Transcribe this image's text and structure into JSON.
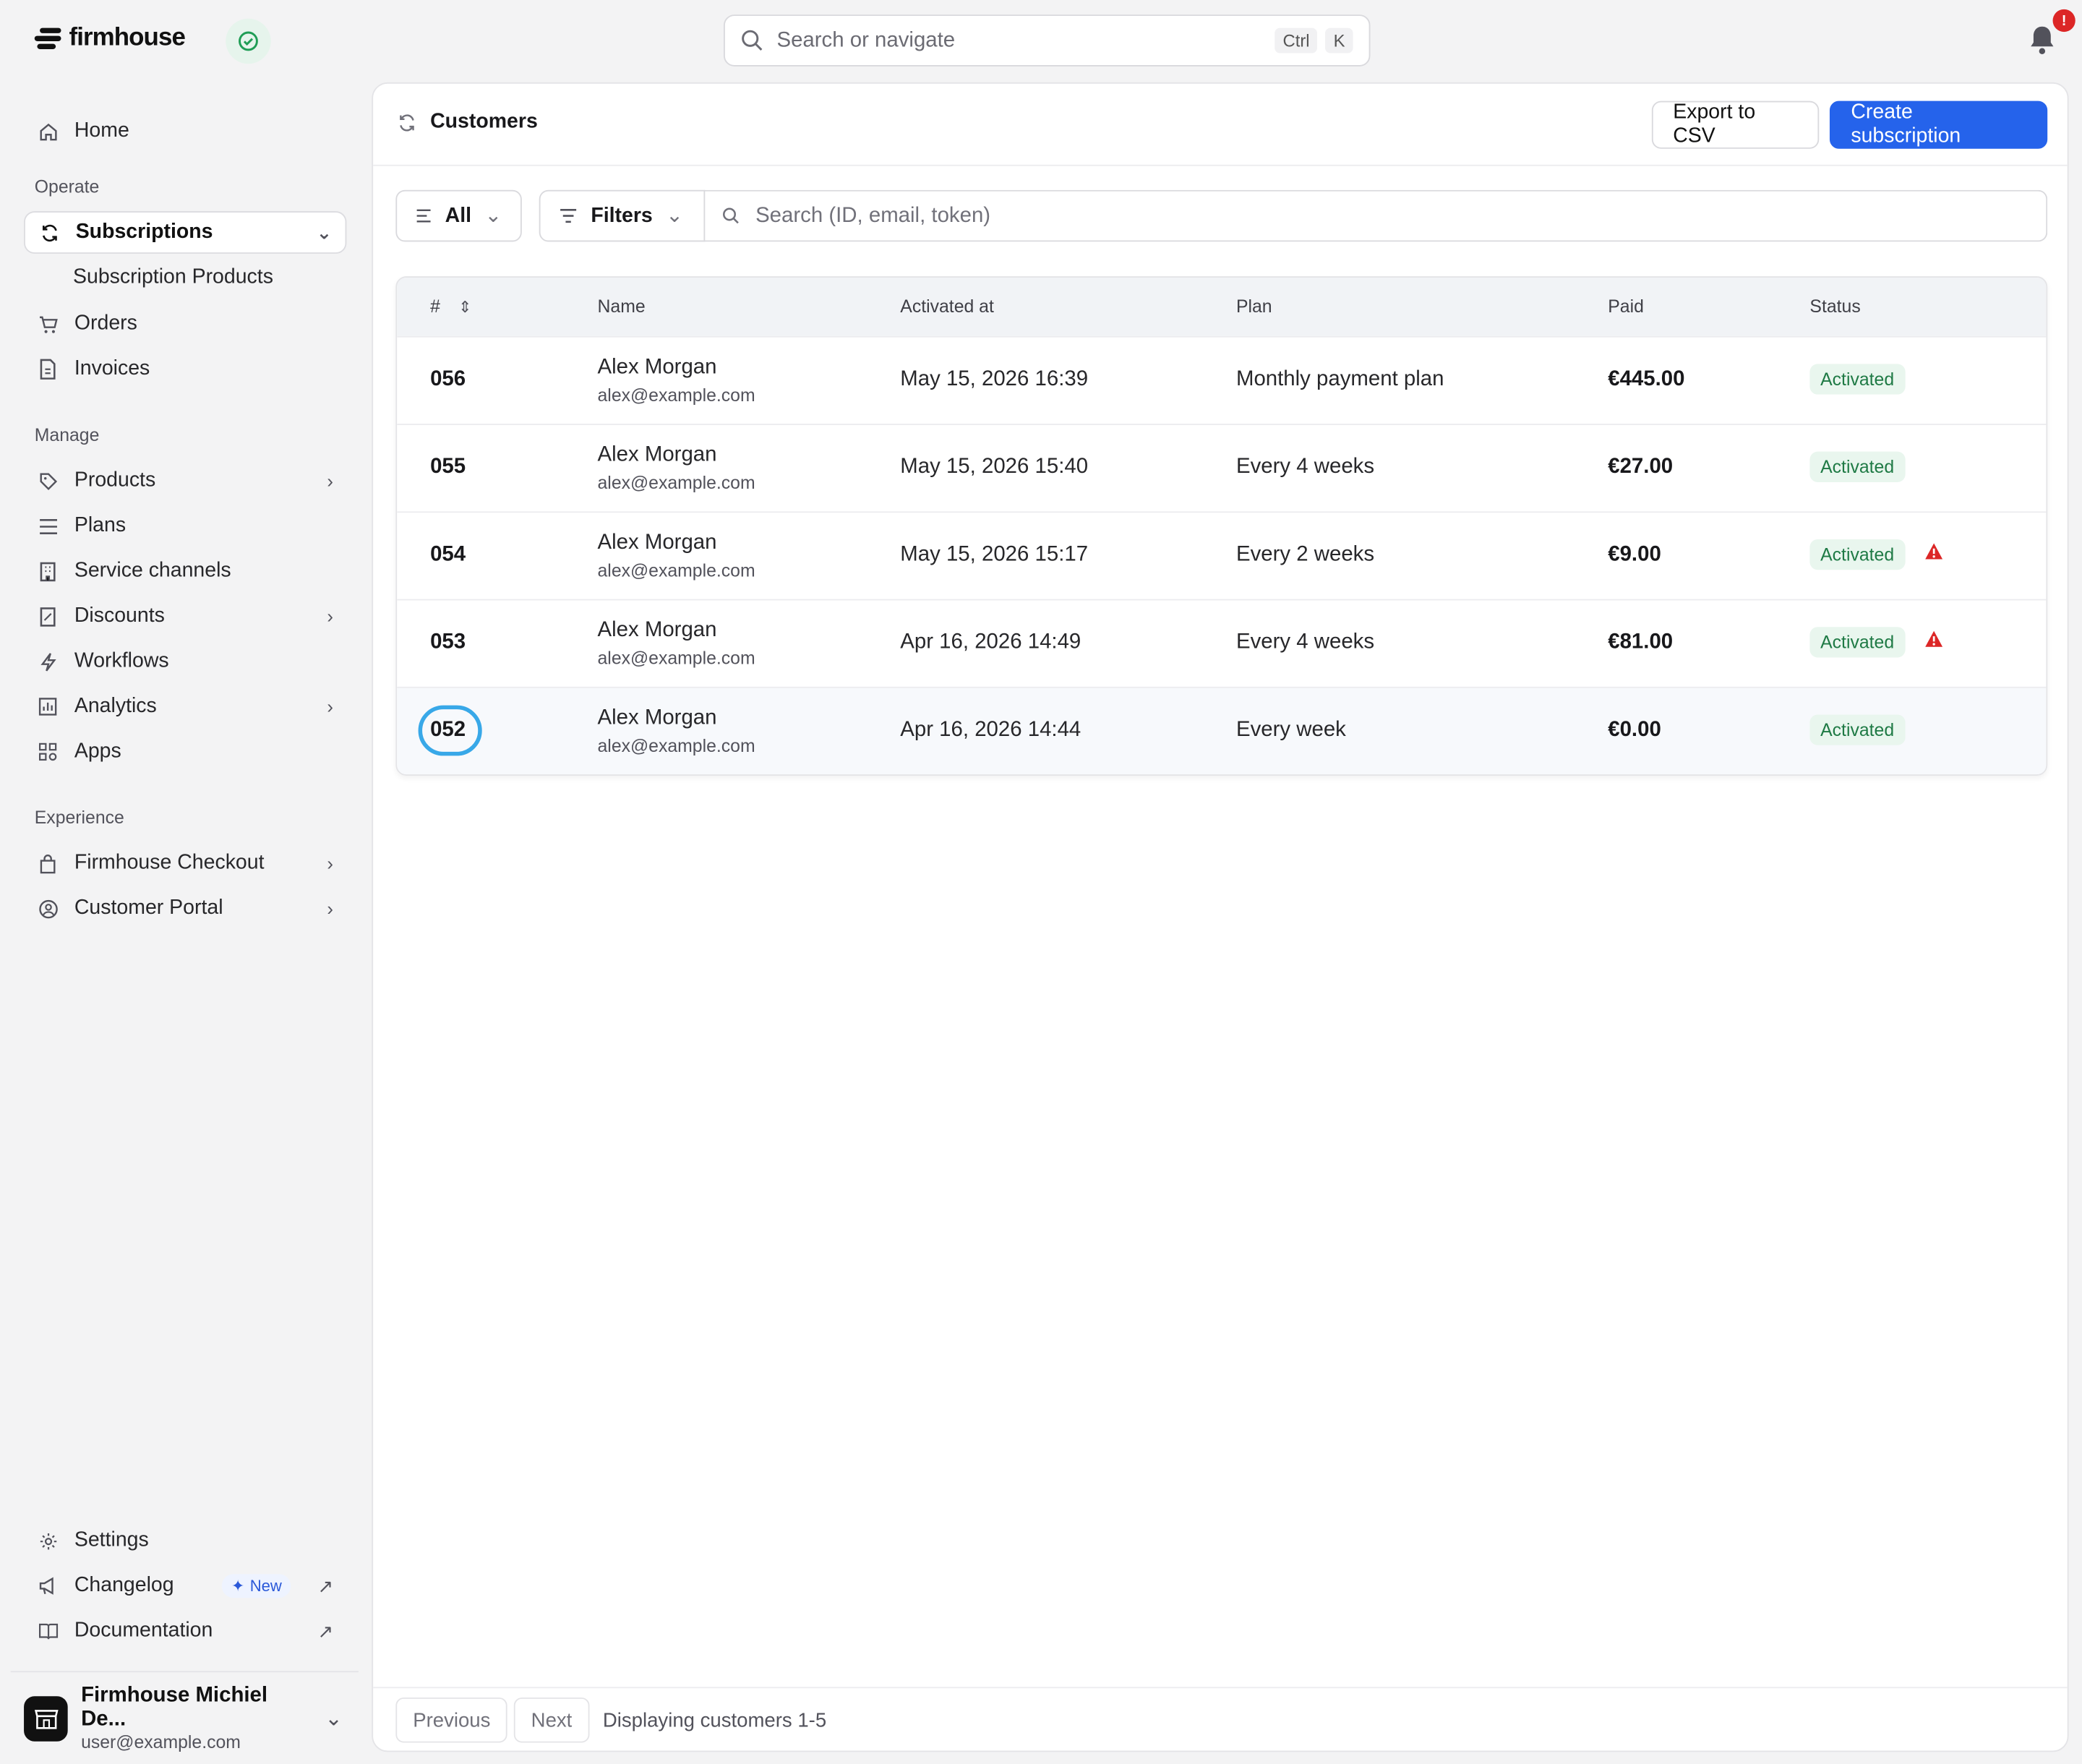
{
  "brand": {
    "name": "firmhouse"
  },
  "global_search": {
    "placeholder": "Search or navigate",
    "kbd": [
      "Ctrl",
      "K"
    ]
  },
  "notifications": {
    "badge": "!"
  },
  "sidebar": {
    "home": "Home",
    "sections": {
      "operate": "Operate",
      "manage": "Manage",
      "experience": "Experience"
    },
    "operate_items": [
      {
        "label": "Subscriptions",
        "icon": "refresh-icon",
        "active": true
      },
      {
        "label": "Subscription Products",
        "sub": true
      },
      {
        "label": "Orders",
        "icon": "cart-icon"
      },
      {
        "label": "Invoices",
        "icon": "document-icon"
      }
    ],
    "manage_items": [
      {
        "label": "Products",
        "icon": "tag-icon"
      },
      {
        "label": "Plans",
        "icon": "list-icon"
      },
      {
        "label": "Service channels",
        "icon": "building-icon"
      },
      {
        "label": "Discounts",
        "icon": "discount-icon"
      },
      {
        "label": "Workflows",
        "icon": "bolt-icon"
      },
      {
        "label": "Analytics",
        "icon": "chart-icon"
      },
      {
        "label": "Apps",
        "icon": "apps-icon"
      }
    ],
    "experience_items": [
      {
        "label": "Firmhouse Checkout",
        "icon": "bag-icon"
      },
      {
        "label": "Customer Portal",
        "icon": "user-circle-icon"
      }
    ],
    "bottom_items": [
      {
        "label": "Settings",
        "icon": "gear-icon"
      },
      {
        "label": "Changelog",
        "icon": "megaphone-icon",
        "badge": "New"
      },
      {
        "label": "Documentation",
        "icon": "book-icon"
      }
    ],
    "account": {
      "name": "Firmhouse Michiel De...",
      "email": "user@example.com"
    }
  },
  "main": {
    "title": "Customers",
    "export_label": "Export to CSV",
    "create_label": "Create subscription",
    "view_select": "All",
    "filters_label": "Filters",
    "search_placeholder": "Search (ID, email, token)",
    "columns": [
      "#",
      "Name",
      "Activated at",
      "Plan",
      "Paid",
      "Status"
    ],
    "rows": [
      {
        "id": "056",
        "name": "Alex Morgan",
        "email": "alex@example.com",
        "activated_at": "May 15, 2026 16:39",
        "plan": "Monthly payment plan",
        "paid": "€445.00",
        "status": "Activated",
        "warning": false
      },
      {
        "id": "055",
        "name": "Alex Morgan",
        "email": "alex@example.com",
        "activated_at": "May 15, 2026 15:40",
        "plan": "Every 4 weeks",
        "paid": "€27.00",
        "status": "Activated",
        "warning": false
      },
      {
        "id": "054",
        "name": "Alex Morgan",
        "email": "alex@example.com",
        "activated_at": "May 15, 2026 15:17",
        "plan": "Every 2 weeks",
        "paid": "€9.00",
        "status": "Activated",
        "warning": true
      },
      {
        "id": "053",
        "name": "Alex Morgan",
        "email": "alex@example.com",
        "activated_at": "Apr 16, 2026 14:49",
        "plan": "Every 4 weeks",
        "paid": "€81.00",
        "status": "Activated",
        "warning": true
      },
      {
        "id": "052",
        "name": "Alex Morgan",
        "email": "alex@example.com",
        "activated_at": "Apr 16, 2026 14:44",
        "plan": "Every week",
        "paid": "€0.00",
        "status": "Activated",
        "warning": false
      }
    ],
    "pagination": {
      "previous": "Previous",
      "next": "Next",
      "info": "Displaying customers 1-5"
    }
  },
  "colors": {
    "primary": "#2563eb",
    "status_bg": "#e9f6ee",
    "status_fg": "#1f7a45",
    "warning": "#dc2626",
    "focus": "#38a8e8"
  }
}
